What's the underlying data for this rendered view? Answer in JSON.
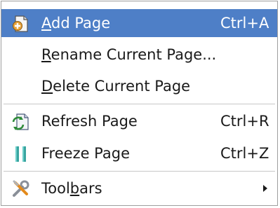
{
  "menu": {
    "items": [
      {
        "pre": "",
        "mnemonic": "A",
        "post": "dd Page",
        "shortcut": "Ctrl+A",
        "icon": "add-page-icon"
      },
      {
        "pre": "",
        "mnemonic": "R",
        "post": "ename Current Page...",
        "shortcut": ""
      },
      {
        "pre": "",
        "mnemonic": "D",
        "post": "elete Current Page",
        "shortcut": ""
      },
      {
        "pre": "Refresh Page",
        "mnemonic": "",
        "post": "",
        "shortcut": "Ctrl+R",
        "icon": "refresh-page-icon"
      },
      {
        "pre": "Freeze Page",
        "mnemonic": "",
        "post": "",
        "shortcut": "Ctrl+Z",
        "icon": "freeze-page-icon"
      },
      {
        "pre": "Tool",
        "mnemonic": "b",
        "post": "ars",
        "shortcut": "",
        "icon": "toolbars-icon",
        "submenu": "chevron-right-icon"
      }
    ]
  },
  "colors": {
    "highlight": "#4e7fc7",
    "highlight_text": "#ffffff",
    "text": "#1a1a1a",
    "separator": "#c8c8c8"
  }
}
